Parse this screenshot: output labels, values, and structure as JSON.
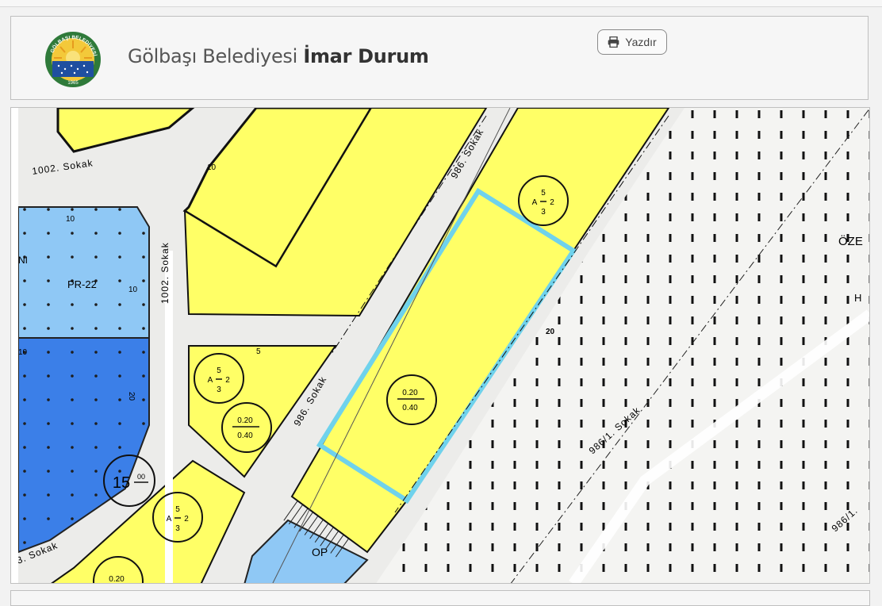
{
  "header": {
    "title_regular": "Gölbaşı Belediyesi",
    "title_bold": "İmar Durum",
    "print_label": "Yazdır",
    "print_icon": "printer-icon",
    "logo_text": "GÖLBAŞI BELEDİYESİ",
    "logo_year": "1965"
  },
  "map": {
    "streets": {
      "s1002_top": "1002. Sokak",
      "s1002_vertical": "1002. Sokak",
      "s986_top": "986. Sokak",
      "s986_mid": "986. Sokak",
      "s9861": "986/1. Sokak",
      "s986_right": "986/1.",
      "sokak_bottom_left": "3. Sokak"
    },
    "zones": {
      "pr22": "PR-22",
      "op": "OP",
      "ozel": "ÖZE",
      "h": "H",
      "ni": "NI"
    },
    "block_labels": {
      "a_top": "5",
      "a_mid": "A",
      "a_dash": "2",
      "a_bot": "3",
      "ratio_top": "0.20",
      "ratio_bot": "0.40",
      "fifteen": "15",
      "fifteen_sup": "00",
      "d5": "5",
      "d10": "10",
      "d20": "20"
    },
    "colors": {
      "residential": "#ffff66",
      "blue_light": "#8fc8f5",
      "blue_dark": "#3b7fe8",
      "road": "#ececea",
      "selection": "#6fd2ec"
    }
  }
}
